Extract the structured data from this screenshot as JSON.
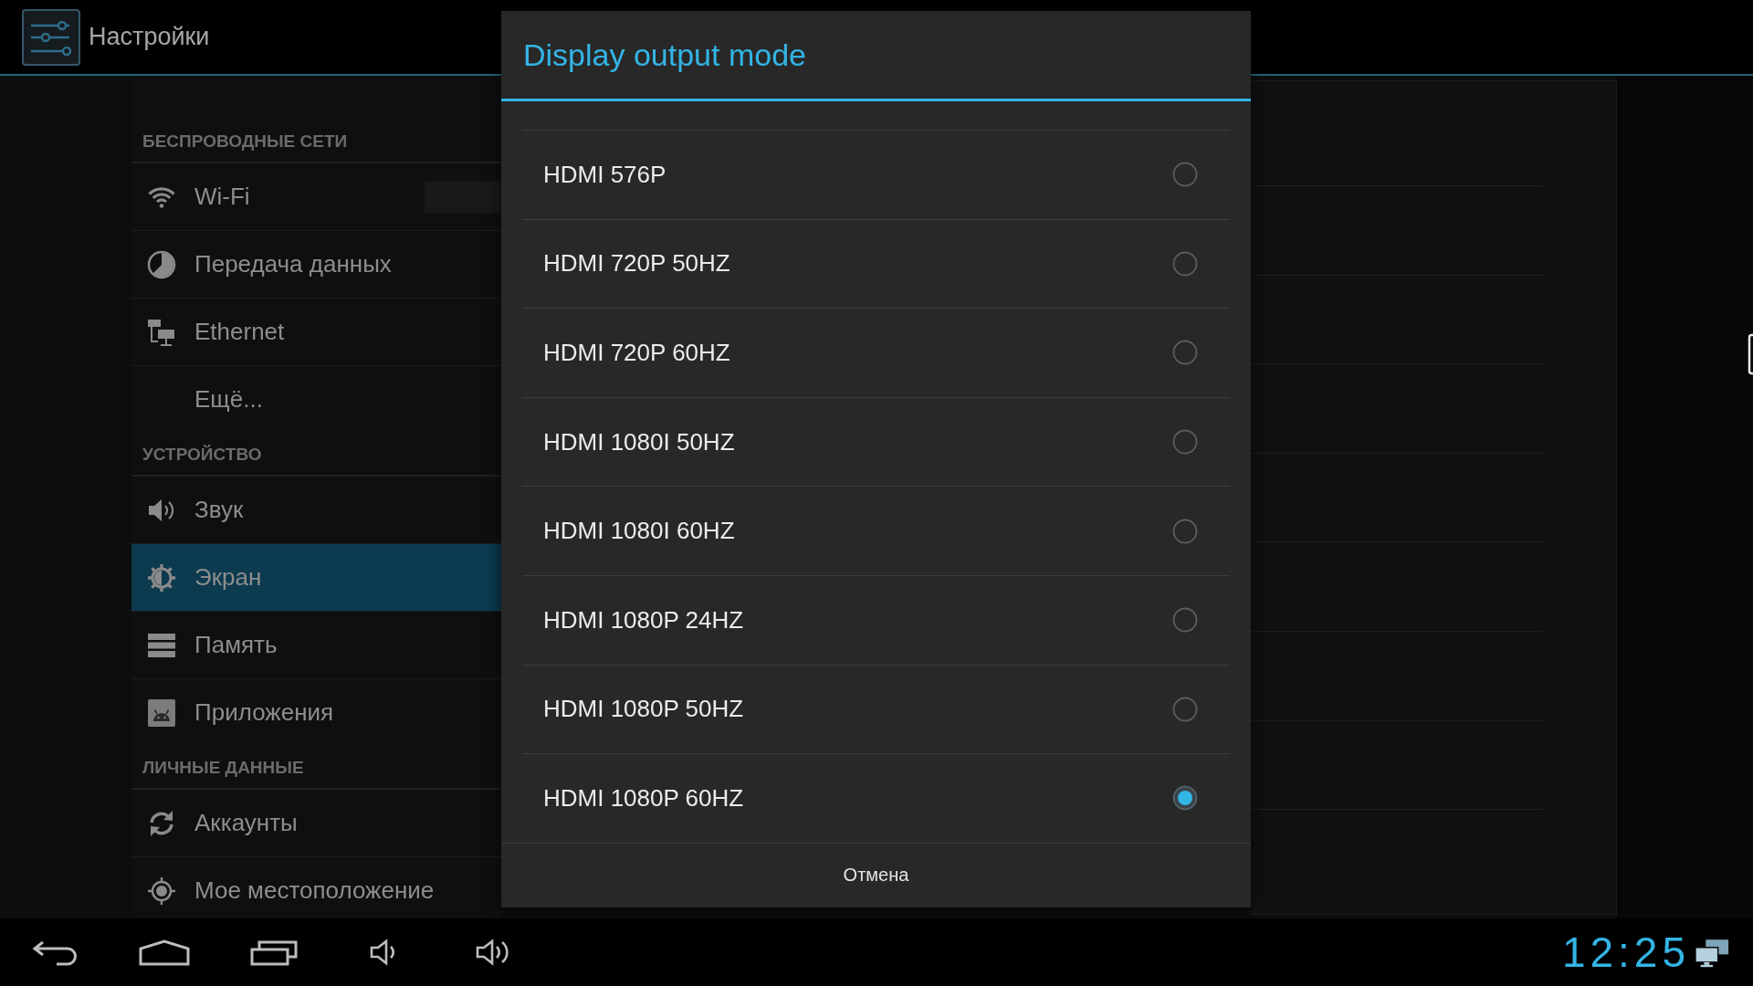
{
  "action_bar": {
    "title": "Настройки"
  },
  "sidebar": {
    "sections": [
      {
        "header": "БЕСПРОВОДНЫЕ СЕТИ",
        "items": [
          {
            "label": "Wi-Fi",
            "kind": "toggle",
            "selected": false
          },
          {
            "label": "Передача данных",
            "kind": "link",
            "selected": false
          },
          {
            "label": "Ethernet",
            "kind": "link",
            "selected": false
          },
          {
            "label": "Ещё...",
            "kind": "link",
            "selected": false
          }
        ]
      },
      {
        "header": "УСТРОЙСТВО",
        "items": [
          {
            "label": "Звук",
            "kind": "link",
            "selected": false
          },
          {
            "label": "Экран",
            "kind": "link",
            "selected": true
          },
          {
            "label": "Память",
            "kind": "link",
            "selected": false
          },
          {
            "label": "Приложения",
            "kind": "link",
            "selected": false
          }
        ]
      },
      {
        "header": "ЛИЧНЫЕ ДАННЫЕ",
        "items": [
          {
            "label": "Аккаунты",
            "kind": "link",
            "selected": false
          },
          {
            "label": "Мое местоположение",
            "kind": "link",
            "selected": false
          }
        ]
      }
    ]
  },
  "dialog": {
    "title": "Display output mode",
    "options": [
      {
        "label": "HDMI 576P",
        "selected": false
      },
      {
        "label": "HDMI 720P 50HZ",
        "selected": false
      },
      {
        "label": "HDMI 720P 60HZ",
        "selected": false
      },
      {
        "label": "HDMI 1080I 50HZ",
        "selected": false
      },
      {
        "label": "HDMI 1080I 60HZ",
        "selected": false
      },
      {
        "label": "HDMI 1080P 24HZ",
        "selected": false
      },
      {
        "label": "HDMI 1080P 50HZ",
        "selected": false
      },
      {
        "label": "HDMI 1080P 60HZ",
        "selected": true
      }
    ],
    "cancel_button": "Отмена"
  },
  "nav_bar": {
    "clock": "12:25"
  }
}
